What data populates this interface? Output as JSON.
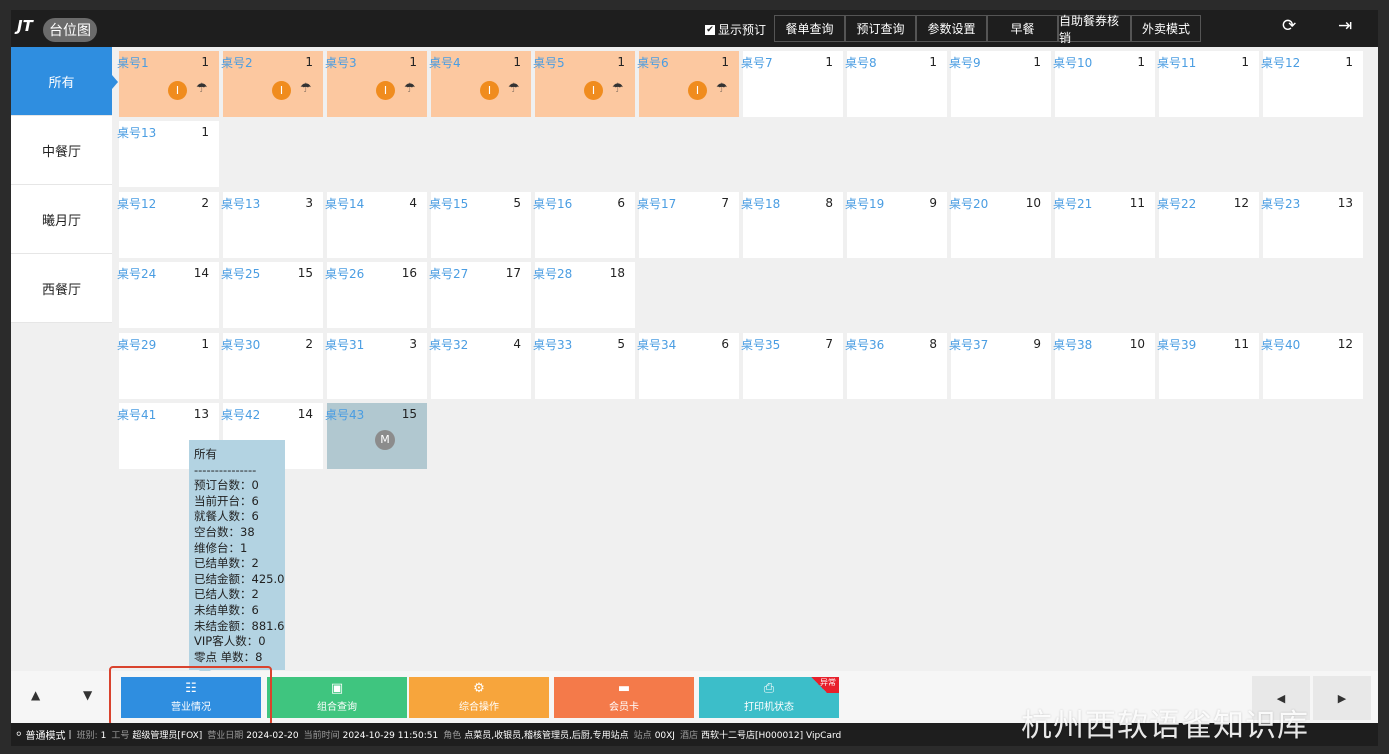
{
  "header": {
    "logo": "JT",
    "title": "台位图",
    "show_booking_label": "显示预订",
    "show_booking_checked": true,
    "buttons": [
      "餐单查询",
      "预订查询",
      "参数设置",
      "早餐",
      "自助餐券核销",
      "外卖模式"
    ],
    "icons": [
      "refresh-icon",
      "logout-icon"
    ]
  },
  "sidebar": {
    "items": [
      {
        "label": "所有",
        "active": true
      },
      {
        "label": "中餐厅"
      },
      {
        "label": "曦月厅"
      },
      {
        "label": "西餐厅"
      }
    ]
  },
  "tables": [
    {
      "name": "桌号1",
      "seats": "1",
      "status": "occupied",
      "badge": "I"
    },
    {
      "name": "桌号2",
      "seats": "1",
      "status": "occupied",
      "badge": "I"
    },
    {
      "name": "桌号3",
      "seats": "1",
      "status": "occupied",
      "badge": "I"
    },
    {
      "name": "桌号4",
      "seats": "1",
      "status": "occupied",
      "badge": "I"
    },
    {
      "name": "桌号5",
      "seats": "1",
      "status": "occupied",
      "badge": "I"
    },
    {
      "name": "桌号6",
      "seats": "1",
      "status": "occupied",
      "badge": "I"
    },
    {
      "name": "桌号7",
      "seats": "1"
    },
    {
      "name": "桌号8",
      "seats": "1"
    },
    {
      "name": "桌号9",
      "seats": "1"
    },
    {
      "name": "桌号10",
      "seats": "1"
    },
    {
      "name": "桌号11",
      "seats": "1"
    },
    {
      "name": "桌号12",
      "seats": "1"
    },
    {
      "name": "桌号13",
      "seats": "1"
    },
    {
      "name": "桌号12",
      "seats": "2"
    },
    {
      "name": "桌号13",
      "seats": "3"
    },
    {
      "name": "桌号14",
      "seats": "4"
    },
    {
      "name": "桌号15",
      "seats": "5"
    },
    {
      "name": "桌号16",
      "seats": "6"
    },
    {
      "name": "桌号17",
      "seats": "7"
    },
    {
      "name": "桌号18",
      "seats": "8"
    },
    {
      "name": "桌号19",
      "seats": "9"
    },
    {
      "name": "桌号20",
      "seats": "10"
    },
    {
      "name": "桌号21",
      "seats": "11"
    },
    {
      "name": "桌号22",
      "seats": "12"
    },
    {
      "name": "桌号23",
      "seats": "13"
    },
    {
      "name": "桌号24",
      "seats": "14"
    },
    {
      "name": "桌号25",
      "seats": "15"
    },
    {
      "name": "桌号26",
      "seats": "16"
    },
    {
      "name": "桌号27",
      "seats": "17"
    },
    {
      "name": "桌号28",
      "seats": "18"
    },
    {
      "name": "桌号29",
      "seats": "1"
    },
    {
      "name": "桌号30",
      "seats": "2"
    },
    {
      "name": "桌号31",
      "seats": "3"
    },
    {
      "name": "桌号32",
      "seats": "4"
    },
    {
      "name": "桌号33",
      "seats": "5"
    },
    {
      "name": "桌号34",
      "seats": "6"
    },
    {
      "name": "桌号35",
      "seats": "7"
    },
    {
      "name": "桌号36",
      "seats": "8"
    },
    {
      "name": "桌号37",
      "seats": "9"
    },
    {
      "name": "桌号38",
      "seats": "10"
    },
    {
      "name": "桌号39",
      "seats": "11"
    },
    {
      "name": "桌号40",
      "seats": "12"
    },
    {
      "name": "桌号41",
      "seats": "13"
    },
    {
      "name": "桌号42",
      "seats": "14"
    },
    {
      "name": "桌号43",
      "seats": "15",
      "status": "maintenance",
      "badge": "M"
    }
  ],
  "summary": {
    "lines": [
      "所有",
      "---------------",
      "预订台数：0",
      "当前开台：6",
      "就餐人数：6",
      "空台数：38",
      "维修台：1",
      "已结单数：2",
      "已结金额：425.0",
      "已结人数：2",
      "未结单数：6",
      "未结金额：881.6",
      "VIP客人数：0",
      "零点 单数：8"
    ]
  },
  "footer": {
    "up_arrow": "▲",
    "down_arrow": "▼",
    "buttons": [
      {
        "label": "营业情况",
        "color": "#2f8ee0",
        "icon": "report-icon"
      },
      {
        "label": "组合查询",
        "color": "#3fc57f",
        "icon": "search-screen-icon"
      },
      {
        "label": "综合操作",
        "color": "#f7a53c",
        "icon": "user-settings-icon"
      },
      {
        "label": "会员卡",
        "color": "#f47a4a",
        "icon": "card-icon"
      },
      {
        "label": "打印机状态",
        "color": "#3cbec9",
        "icon": "printer-alert-icon",
        "corner_badge": "异常"
      }
    ],
    "prev": "◀",
    "next": "▶"
  },
  "status_bar": {
    "mode": "普通模式",
    "fields": [
      {
        "label": "班别:",
        "value": "1"
      },
      {
        "label": "工号",
        "value": "超级管理员[FOX]"
      },
      {
        "label": "营业日期",
        "value": "2024-02-20"
      },
      {
        "label": "当前时间",
        "value": "2024-10-29 11:50:51"
      },
      {
        "label": "角色",
        "value": "点菜员,收银员,稽核管理员,后厨,专用站点"
      },
      {
        "label": "站点",
        "value": "00XJ"
      },
      {
        "label": "酒店",
        "value": "西软十二号店[H000012] VipCard"
      }
    ]
  },
  "watermark": "杭州西软语雀知识库"
}
